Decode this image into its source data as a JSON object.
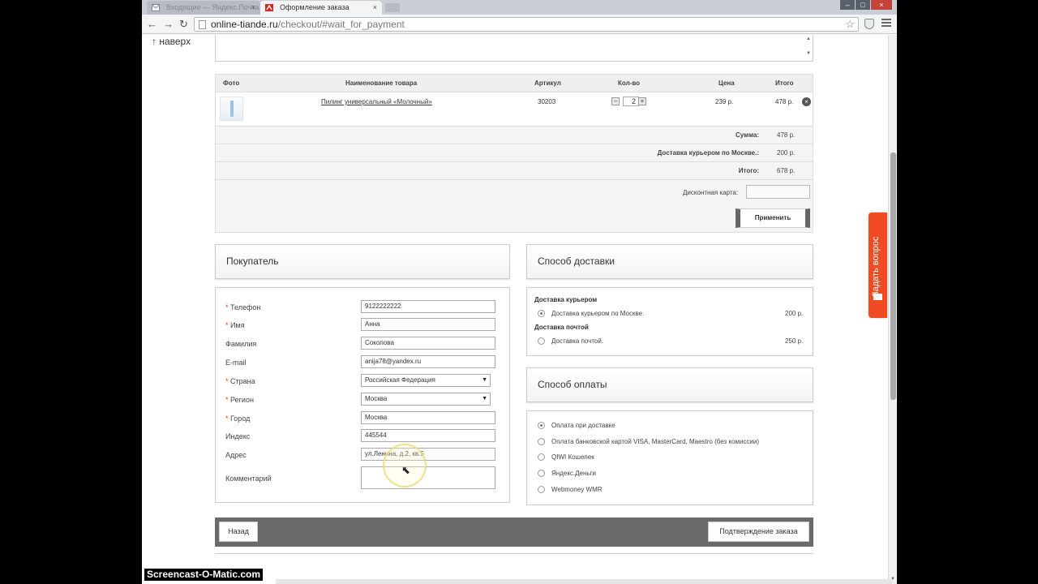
{
  "browser": {
    "tabs": [
      {
        "label": "Входящие — Яндекс.Почта",
        "active": false
      },
      {
        "label": "Оформление заказа",
        "active": true
      }
    ],
    "url_domain": "online-tiande.ru",
    "url_path": "/checkout/#wait_for_payment"
  },
  "page": {
    "to_top": "↑ наверх",
    "cart": {
      "headers": {
        "photo": "Фото",
        "name": "Наименование товара",
        "sku": "Артикул",
        "qty": "Кол-во",
        "price": "Цена",
        "total": "Итого"
      },
      "item": {
        "name": "Пилинг универсальный «Молочный»",
        "sku": "30203",
        "qty": "2",
        "price": "239 р.",
        "total": "478 р."
      },
      "summary": [
        {
          "label": "Сумма:",
          "value": "478 р."
        },
        {
          "label": "Доставка курьером по Москве.:",
          "value": "200 р."
        },
        {
          "label": "Итого:",
          "value": "678 р."
        }
      ],
      "discount_label": "Дисконтная карта:",
      "apply_label": "Применить"
    },
    "buyer": {
      "title": "Покупатель",
      "fields": {
        "phone": {
          "label": "Телефон",
          "value": "9122222222",
          "required": true
        },
        "name": {
          "label": "Имя",
          "value": "Анна",
          "required": true
        },
        "surname": {
          "label": "Фамилия",
          "value": "Соколова",
          "required": false
        },
        "email": {
          "label": "E-mail",
          "value": "anija78@yandex.ru",
          "required": false
        },
        "country": {
          "label": "Страна",
          "value": "Российская Федерация",
          "required": true
        },
        "region": {
          "label": "Регион",
          "value": "Москва",
          "required": true
        },
        "city": {
          "label": "Город",
          "value": "Москва",
          "required": true
        },
        "zip": {
          "label": "Индекс",
          "value": "445544",
          "required": false
        },
        "address": {
          "label": "Адрес",
          "value": "ул.Ленина, д.2, кв.5",
          "required": false
        },
        "comment": {
          "label": "Комментарий",
          "value": "",
          "required": false
        }
      },
      "required_mark": "*"
    },
    "delivery": {
      "title": "Способ доставки",
      "courier_group": "Доставка курьером",
      "courier_option": "Доставка курьером по Москве.",
      "courier_price": "200 р.",
      "post_group": "Доставка почтой",
      "post_option": "Доставка почтой.",
      "post_price": "250 р."
    },
    "payment": {
      "title": "Способ оплаты",
      "options": [
        "Оплата при доставке",
        "Оплата банковской картой VISA, MasterCard, Maestro (без комиссии)",
        "QIWI Кошелек",
        "Яндекс.Деньги",
        "Webmoney WMR"
      ],
      "selected_index": 0
    },
    "buttons": {
      "back": "Назад",
      "confirm": "Подтверждение заказа"
    }
  },
  "side_tab": {
    "label": "Задать вопрос"
  },
  "watermark": "Screencast-O-Matic.com",
  "colors": {
    "accent": "#f04b22",
    "required": "#e0401f",
    "footer_bar": "#6a6a6a"
  }
}
